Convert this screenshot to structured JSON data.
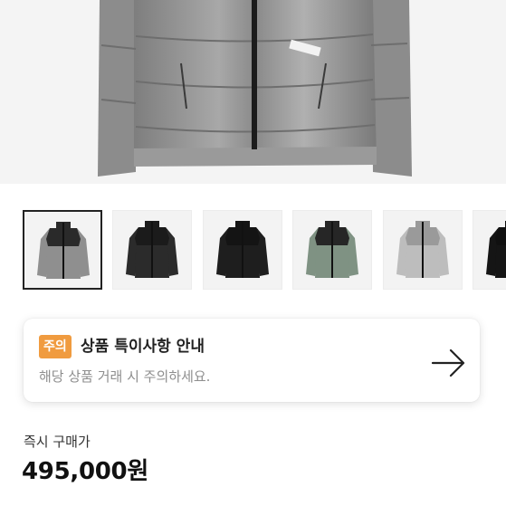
{
  "product_images": {
    "main_image": "grey-down-jacket",
    "thumbnails": [
      {
        "name": "thumbnail-grey-jacket",
        "body": "#8f8f8f",
        "yoke": "#2a2a2a",
        "selected": true
      },
      {
        "name": "thumbnail-black-glossy-jacket",
        "body": "#2b2b2b",
        "yoke": "#1b1b1b",
        "selected": false
      },
      {
        "name": "thumbnail-black-jacket",
        "body": "#1e1e1e",
        "yoke": "#141414",
        "selected": false
      },
      {
        "name": "thumbnail-green-jacket",
        "body": "#7f9283",
        "yoke": "#262626",
        "selected": false
      },
      {
        "name": "thumbnail-camo-jacket",
        "body": "#bdbdbd",
        "yoke": "#9a9a9a",
        "selected": false
      },
      {
        "name": "thumbnail-black-jacket-partial",
        "body": "#151515",
        "yoke": "#101010",
        "selected": false
      }
    ]
  },
  "notice": {
    "badge": "주의",
    "title": "상품 특이사항 안내",
    "description": "해당 상품 거래 시 주의하세요.",
    "arrow_icon": "arrow-right-icon"
  },
  "price": {
    "label": "즉시 구매가",
    "value": "495,000원"
  },
  "colors": {
    "badge": "#f09b3f",
    "text_primary": "#222222",
    "text_secondary": "#8e8e8e"
  }
}
